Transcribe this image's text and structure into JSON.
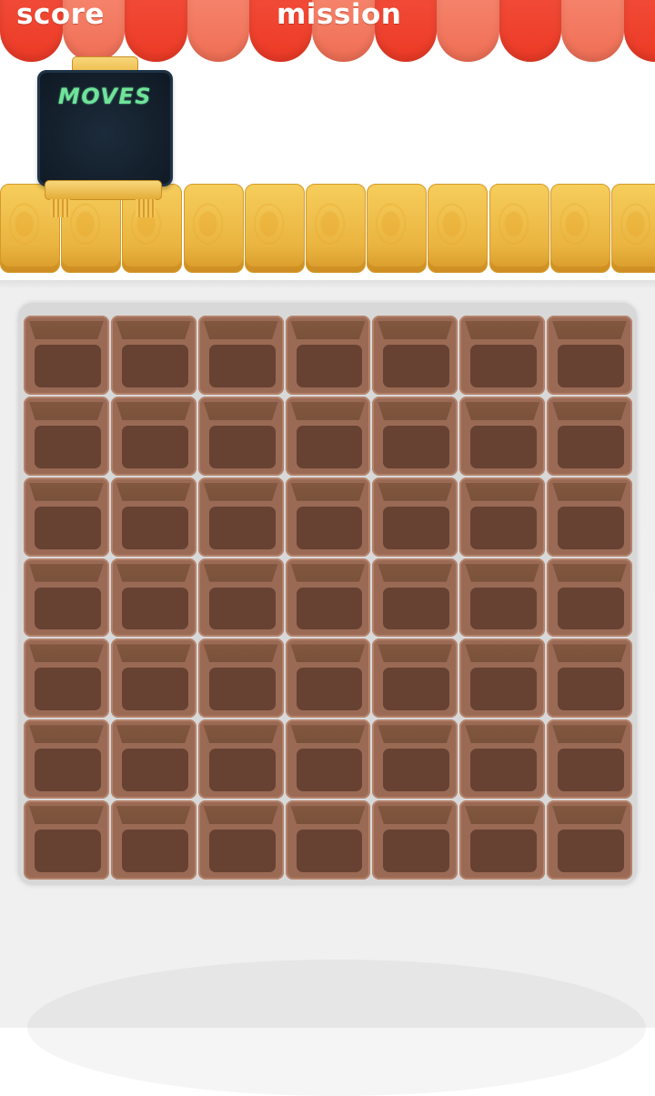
{
  "hud": {
    "score_label": "score",
    "mission_label": "mission",
    "moves_label": "MOVES"
  },
  "board": {
    "rows": 7,
    "cols": 7
  },
  "colors": {
    "awning_dark": "#ec3a26",
    "awning_light": "#f06e55",
    "shelf_wood": "#eab440",
    "chalkboard": "#14202c",
    "chalk_text": "#6fe39a",
    "cell": "#9a6a55",
    "cell_pit": "#674233"
  }
}
